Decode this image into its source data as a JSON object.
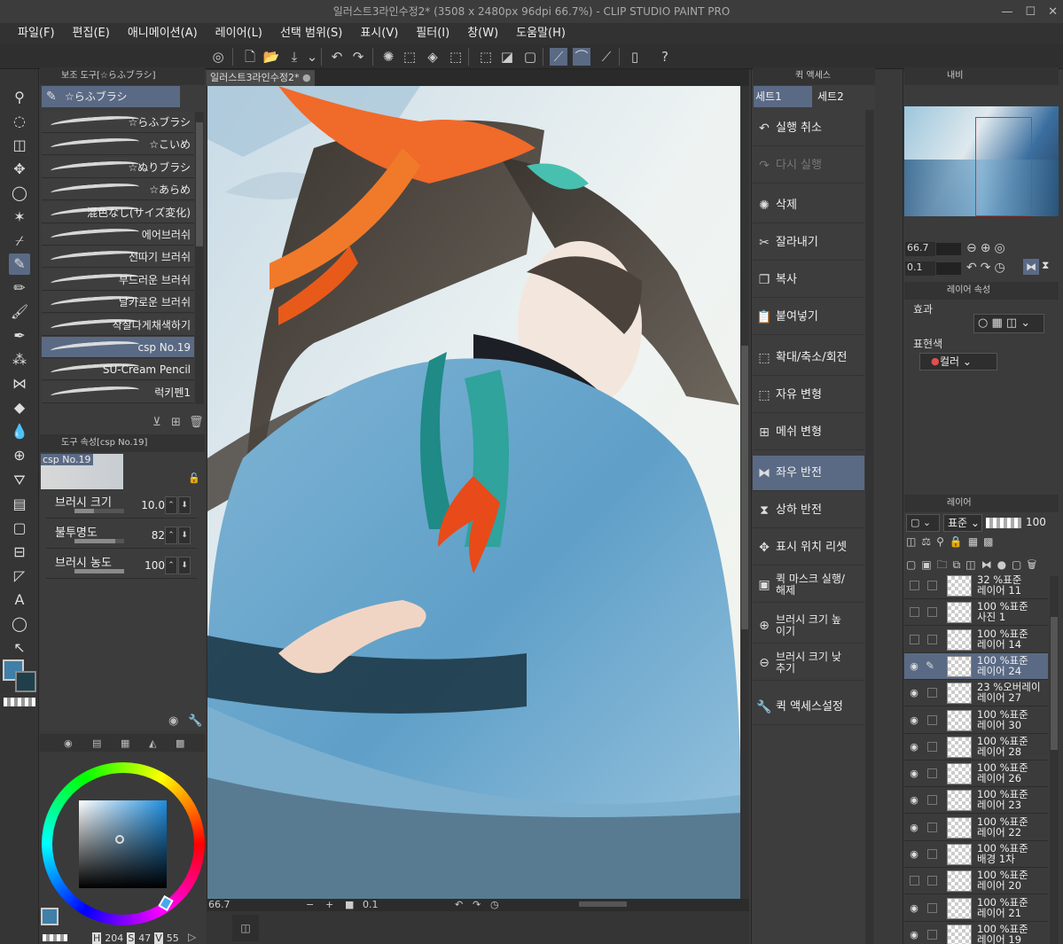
{
  "window": {
    "title": "일러스트3라인수정2* (3508 x 2480px 96dpi 66.7%)  - CLIP STUDIO PAINT PRO",
    "minimize": "—",
    "maximize": "☐",
    "close": "✕"
  },
  "menu": [
    "파일(F)",
    "편집(E)",
    "애니메이션(A)",
    "레이어(L)",
    "선택 범위(S)",
    "표시(V)",
    "필터(I)",
    "창(W)",
    "도움말(H)"
  ],
  "subtool": {
    "header": "보조 도구[☆らふブラシ]",
    "group": "☆らふブラシ",
    "brushes": [
      {
        "label": "☆らふブラシ",
        "selected": false
      },
      {
        "label": "☆こいめ",
        "selected": false
      },
      {
        "label": "☆ぬりブラシ",
        "selected": false
      },
      {
        "label": "☆あらめ",
        "selected": false
      },
      {
        "label": "混色なし(サイズ変化)",
        "selected": false
      },
      {
        "label": "에어브러쉬",
        "selected": false
      },
      {
        "label": "선따기 브러쉬",
        "selected": false
      },
      {
        "label": "부드러운 브러쉬",
        "selected": false
      },
      {
        "label": "날카로운 브러쉬",
        "selected": false
      },
      {
        "label": "작살나게채색하기",
        "selected": false
      },
      {
        "label": "csp No.19",
        "selected": true
      },
      {
        "label": "SU-Cream Pencil",
        "selected": false
      },
      {
        "label": "럭키펜1",
        "selected": false
      }
    ]
  },
  "toolprop": {
    "header": "도구 속성[csp No.19]",
    "preview_name": "csp No.19",
    "props": [
      {
        "label": "브러시 크기",
        "value": "10.0",
        "fill": 0.4
      },
      {
        "label": "불투명도",
        "value": "82",
        "fill": 0.82
      },
      {
        "label": "브러시 농도",
        "value": "100",
        "fill": 1.0
      }
    ]
  },
  "color": {
    "main": "#3f7fa8",
    "sub": "#1f3f4a",
    "readout": {
      "h_label": "H",
      "h": "204",
      "s_label": "S",
      "s": "47",
      "v_label": "V",
      "v": "55"
    }
  },
  "canvas": {
    "tab": "일러스트3라인수정2*",
    "zoom": "66.7",
    "rotate": "0.1"
  },
  "quick_access": {
    "header": "퀵 액세스",
    "tabs": [
      "세트1",
      "세트2"
    ],
    "items": [
      {
        "label": "실행 취소",
        "icon": "undo-icon",
        "glyph": "↶",
        "disabled": false,
        "selected": false,
        "two": false
      },
      {
        "label": "다시 실행",
        "icon": "redo-icon",
        "glyph": "↷",
        "disabled": true,
        "selected": false,
        "two": false
      },
      {
        "label": "삭제",
        "icon": "clear-icon",
        "glyph": "✺",
        "disabled": false,
        "selected": false,
        "two": false
      },
      {
        "label": "잘라내기",
        "icon": "scissors-icon",
        "glyph": "✂",
        "disabled": false,
        "selected": false,
        "two": false
      },
      {
        "label": "복사",
        "icon": "copy-icon",
        "glyph": "❐",
        "disabled": false,
        "selected": false,
        "two": false
      },
      {
        "label": "붙여넣기",
        "icon": "paste-icon",
        "glyph": "📋",
        "disabled": false,
        "selected": false,
        "two": false
      },
      {
        "label": "확대/축소/회전",
        "icon": "scale-rotate-icon",
        "glyph": "⬚",
        "disabled": false,
        "selected": false,
        "two": false
      },
      {
        "label": "자유 변형",
        "icon": "free-transform-icon",
        "glyph": "⬚",
        "disabled": false,
        "selected": false,
        "two": false
      },
      {
        "label": "메쉬 변형",
        "icon": "mesh-transform-icon",
        "glyph": "⊞",
        "disabled": false,
        "selected": false,
        "two": false
      },
      {
        "label": "좌우 반전",
        "icon": "flip-horizontal-icon",
        "glyph": "⧓",
        "disabled": false,
        "selected": true,
        "two": false
      },
      {
        "label": "상하 반전",
        "icon": "flip-vertical-icon",
        "glyph": "⧗",
        "disabled": false,
        "selected": false,
        "two": false
      },
      {
        "label": "표시 위치 리셋",
        "icon": "reset-view-icon",
        "glyph": "✥",
        "disabled": false,
        "selected": false,
        "two": false
      },
      {
        "label": "퀵 마스크 실행/\n해제",
        "icon": "quick-mask-icon",
        "glyph": "▣",
        "disabled": false,
        "selected": false,
        "two": true
      },
      {
        "label": "브러시 크기 높\n이기",
        "icon": "brush-size-up-icon",
        "glyph": "⊕",
        "disabled": false,
        "selected": false,
        "two": true
      },
      {
        "label": "브러시 크기 낮\n추기",
        "icon": "brush-size-down-icon",
        "glyph": "⊖",
        "disabled": false,
        "selected": false,
        "two": true
      },
      {
        "label": "퀵 액세스설정",
        "icon": "wrench-icon",
        "glyph": "🔧",
        "disabled": false,
        "selected": false,
        "two": false
      }
    ]
  },
  "navigator": {
    "header": "내비",
    "zoom": "66.7",
    "rotate": "0.1"
  },
  "layer_property": {
    "header": "레이어 속성",
    "effect_label": "효과",
    "expression_label": "표현색",
    "expression_value": "컬러"
  },
  "layers": {
    "header": "레이어",
    "blend": "표준",
    "opacity": "100",
    "rows": [
      {
        "l1": "32 %표준",
        "l2": "레이어 11",
        "visible": false,
        "selected": false
      },
      {
        "l1": "100 %표준",
        "l2": "사진 1",
        "visible": false,
        "selected": false
      },
      {
        "l1": "100 %표준",
        "l2": "레이어 14",
        "visible": false,
        "selected": false
      },
      {
        "l1": "100 %표준",
        "l2": "레이어 24",
        "visible": true,
        "selected": true
      },
      {
        "l1": "23 %오버레이",
        "l2": "레이어 27",
        "visible": true,
        "selected": false
      },
      {
        "l1": "100 %표준",
        "l2": "레이어 30",
        "visible": true,
        "selected": false
      },
      {
        "l1": "100 %표준",
        "l2": "레이어 28",
        "visible": true,
        "selected": false
      },
      {
        "l1": "100 %표준",
        "l2": "레이어 26",
        "visible": true,
        "selected": false
      },
      {
        "l1": "100 %표준",
        "l2": "레이어 23",
        "visible": true,
        "selected": false
      },
      {
        "l1": "100 %표준",
        "l2": "레이어 22",
        "visible": true,
        "selected": false
      },
      {
        "l1": "100 %표준",
        "l2": "배경 1차",
        "visible": true,
        "selected": false
      },
      {
        "l1": "100 %표준",
        "l2": "레이어 20",
        "visible": false,
        "selected": false
      },
      {
        "l1": "100 %표준",
        "l2": "레이어 21",
        "visible": true,
        "selected": false
      },
      {
        "l1": "100 %표준",
        "l2": "레이어 19",
        "visible": true,
        "selected": false
      }
    ]
  }
}
